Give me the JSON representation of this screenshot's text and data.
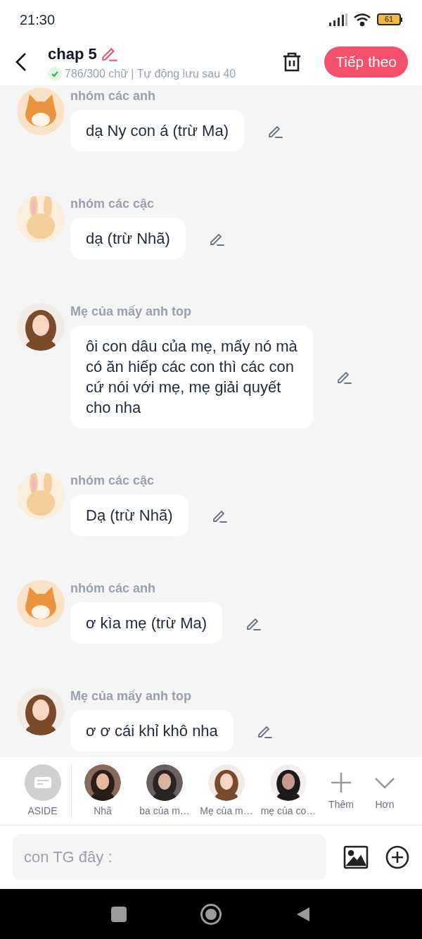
{
  "status_bar": {
    "time": "21:30",
    "battery": "61"
  },
  "header": {
    "title": "chap 5",
    "subtitle": "786/300 chữ | Tự động lưu sau 40",
    "next_button": "Tiếp theo"
  },
  "messages": [
    {
      "sender": "nhóm các anh",
      "text": "dạ Ny con á (trừ Ma)"
    },
    {
      "sender": "nhóm các cậc",
      "text": "dạ (trừ Nhã)"
    },
    {
      "sender": "Mẹ của mấy anh top",
      "text": "ôi con dâu của mẹ, mấy nó mà có ăn hiếp các con thì các con cứ nói với mẹ, mẹ giải quyết cho nha"
    },
    {
      "sender": "nhóm các cậc",
      "text": "Dạ (trừ Nhã)"
    },
    {
      "sender": "nhóm các anh",
      "text": "ơ kìa mẹ (trừ Ma)"
    },
    {
      "sender": "Mẹ của mấy anh top",
      "text": "ơ ơ cái khỉ khô nha"
    }
  ],
  "characters": [
    {
      "kind": "aside",
      "label": "ASIDE"
    },
    {
      "kind": "avatar",
      "label": "Nhã"
    },
    {
      "kind": "avatar",
      "label": "ba của m…"
    },
    {
      "kind": "avatar",
      "label": "Mẹ của m…"
    },
    {
      "kind": "avatar",
      "label": "mẹ của co…"
    },
    {
      "kind": "add",
      "label": "Thêm"
    },
    {
      "kind": "more",
      "label": "Hơn"
    }
  ],
  "composer": {
    "placeholder": "con TG đây :"
  }
}
